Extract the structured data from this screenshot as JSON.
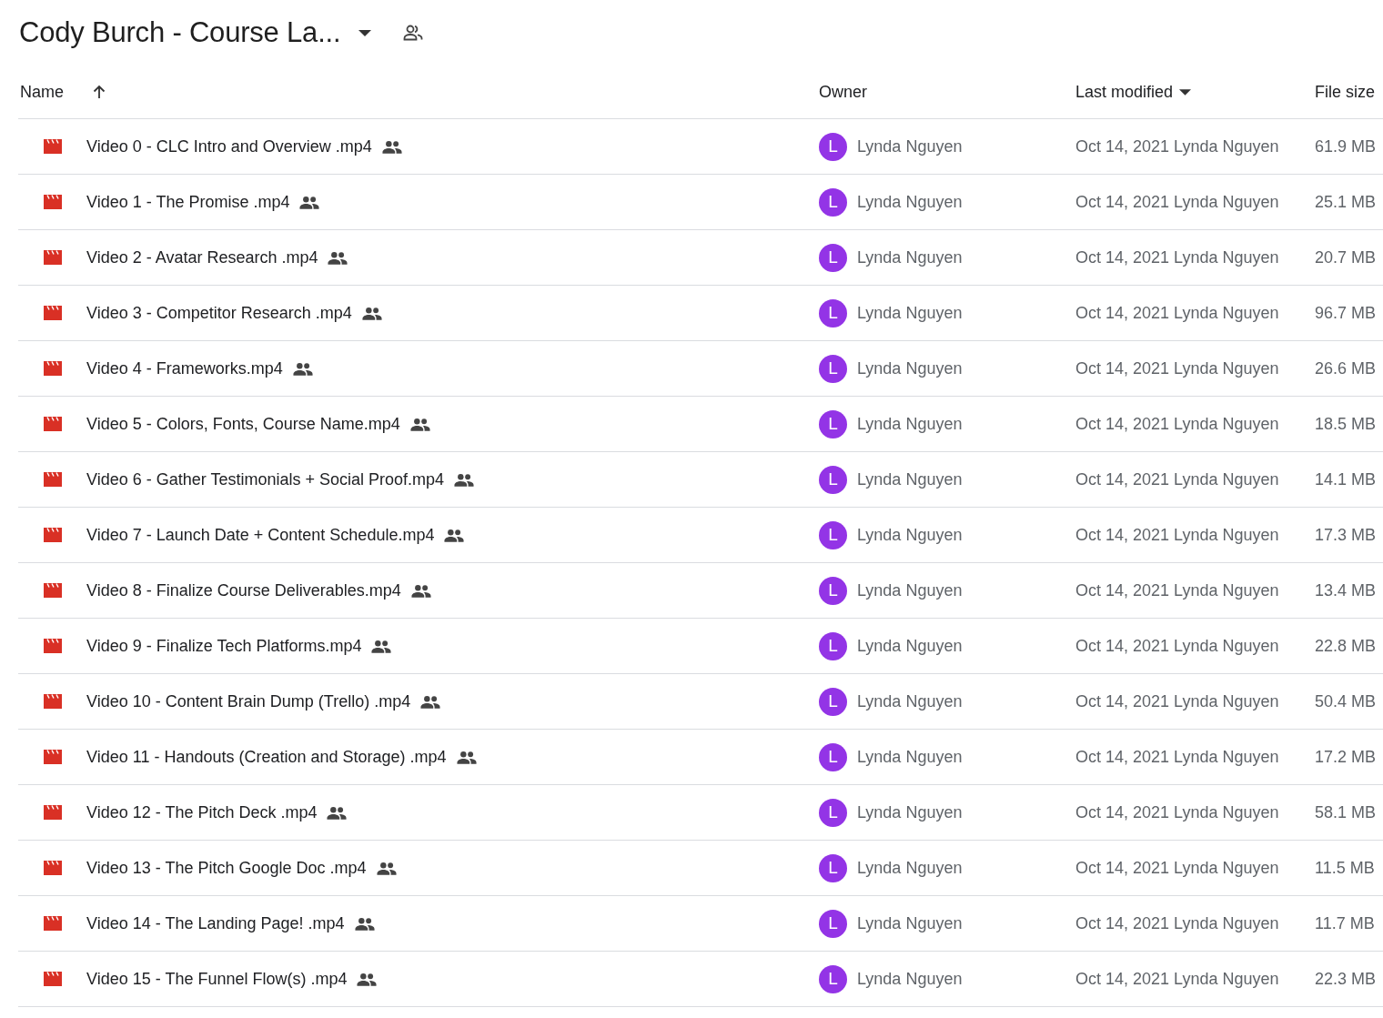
{
  "title": "Cody Burch - Course La...",
  "table": {
    "columns": [
      {
        "label": "Name",
        "sorted": true,
        "ascending": true
      },
      {
        "label": "Owner"
      },
      {
        "label": "Last modified",
        "sorted": true,
        "ascending": false
      },
      {
        "label": "File size"
      }
    ],
    "rows": [
      {
        "name": "Video 0 - CLC Intro and Overview .mp4",
        "shared": true,
        "owner_initial": "L",
        "owner": "Lynda Nguyen",
        "modified": "Oct 14, 2021 Lynda Nguyen",
        "size": "61.9 MB"
      },
      {
        "name": "Video 1 - The Promise .mp4",
        "shared": true,
        "owner_initial": "L",
        "owner": "Lynda Nguyen",
        "modified": "Oct 14, 2021 Lynda Nguyen",
        "size": "25.1 MB"
      },
      {
        "name": "Video 2 - Avatar Research .mp4",
        "shared": true,
        "owner_initial": "L",
        "owner": "Lynda Nguyen",
        "modified": "Oct 14, 2021 Lynda Nguyen",
        "size": "20.7 MB"
      },
      {
        "name": "Video 3 - Competitor Research .mp4",
        "shared": true,
        "owner_initial": "L",
        "owner": "Lynda Nguyen",
        "modified": "Oct 14, 2021 Lynda Nguyen",
        "size": "96.7 MB"
      },
      {
        "name": "Video 4 - Frameworks.mp4",
        "shared": true,
        "owner_initial": "L",
        "owner": "Lynda Nguyen",
        "modified": "Oct 14, 2021 Lynda Nguyen",
        "size": "26.6 MB"
      },
      {
        "name": "Video 5 - Colors, Fonts, Course Name.mp4",
        "shared": true,
        "owner_initial": "L",
        "owner": "Lynda Nguyen",
        "modified": "Oct 14, 2021 Lynda Nguyen",
        "size": "18.5 MB"
      },
      {
        "name": "Video 6 - Gather Testimonials + Social Proof.mp4",
        "shared": true,
        "owner_initial": "L",
        "owner": "Lynda Nguyen",
        "modified": "Oct 14, 2021 Lynda Nguyen",
        "size": "14.1 MB"
      },
      {
        "name": "Video 7 - Launch Date + Content Schedule.mp4",
        "shared": true,
        "owner_initial": "L",
        "owner": "Lynda Nguyen",
        "modified": "Oct 14, 2021 Lynda Nguyen",
        "size": "17.3 MB"
      },
      {
        "name": "Video 8 - Finalize Course Deliverables.mp4",
        "shared": true,
        "owner_initial": "L",
        "owner": "Lynda Nguyen",
        "modified": "Oct 14, 2021 Lynda Nguyen",
        "size": "13.4 MB"
      },
      {
        "name": "Video 9 - Finalize Tech Platforms.mp4",
        "shared": true,
        "owner_initial": "L",
        "owner": "Lynda Nguyen",
        "modified": "Oct 14, 2021 Lynda Nguyen",
        "size": "22.8 MB"
      },
      {
        "name": "Video 10 - Content Brain Dump (Trello) .mp4",
        "shared": true,
        "owner_initial": "L",
        "owner": "Lynda Nguyen",
        "modified": "Oct 14, 2021 Lynda Nguyen",
        "size": "50.4 MB"
      },
      {
        "name": "Video 11 - Handouts (Creation and Storage) .mp4",
        "shared": true,
        "owner_initial": "L",
        "owner": "Lynda Nguyen",
        "modified": "Oct 14, 2021 Lynda Nguyen",
        "size": "17.2 MB"
      },
      {
        "name": "Video 12 - The Pitch Deck .mp4",
        "shared": true,
        "owner_initial": "L",
        "owner": "Lynda Nguyen",
        "modified": "Oct 14, 2021 Lynda Nguyen",
        "size": "58.1 MB"
      },
      {
        "name": "Video 13 - The Pitch Google Doc .mp4",
        "shared": true,
        "owner_initial": "L",
        "owner": "Lynda Nguyen",
        "modified": "Oct 14, 2021 Lynda Nguyen",
        "size": "11.5 MB"
      },
      {
        "name": "Video 14 - The Landing Page! .mp4",
        "shared": true,
        "owner_initial": "L",
        "owner": "Lynda Nguyen",
        "modified": "Oct 14, 2021 Lynda Nguyen",
        "size": "11.7 MB"
      },
      {
        "name": "Video 15 - The Funnel Flow(s) .mp4",
        "shared": true,
        "owner_initial": "L",
        "owner": "Lynda Nguyen",
        "modified": "Oct 14, 2021 Lynda Nguyen",
        "size": "22.3 MB"
      }
    ]
  }
}
